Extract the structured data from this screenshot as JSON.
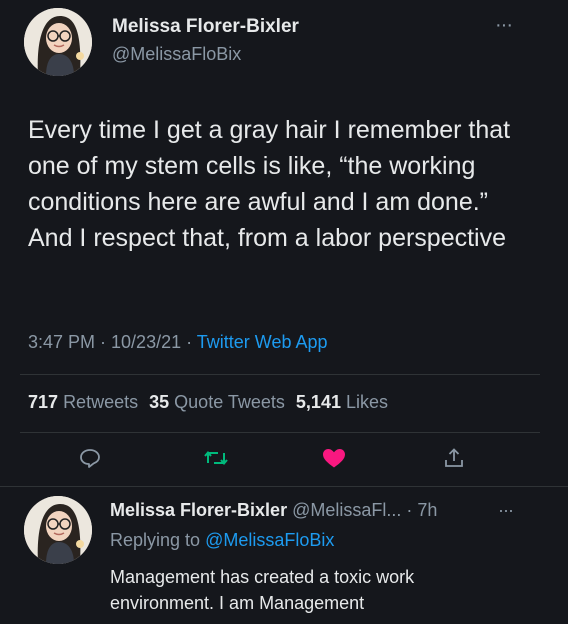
{
  "main_tweet": {
    "display_name": "Melissa Florer-Bixler",
    "handle": "@MelissaFloBix",
    "text": "Every time I get a gray hair I remember that one of my stem cells is like, “the working conditions here are awful and I am done.” And I respect that, from a labor perspective",
    "time": "3:47 PM · 10/23/21 ·",
    "source": "Twitter Web App",
    "retweets_count": "717",
    "retweets_label": "Retweets",
    "quote_count": "35",
    "quote_label": "Quote Tweets",
    "likes_count": "5,141",
    "likes_label": "Likes",
    "more_glyph": "···"
  },
  "actions": {
    "reply_icon": "reply-icon",
    "retweet_icon": "retweet-icon",
    "like_icon": "heart-icon",
    "share_icon": "share-icon",
    "like_color": "#f91880",
    "retweet_color": "#00ba7c"
  },
  "reply_tweet": {
    "display_name": "Melissa Florer-Bixler",
    "handle_time": "@MelissaFl... · 7h",
    "replying_prefix": "Replying to",
    "replying_handle": "@MelissaFloBix",
    "text": "Management has created a toxic work environment. I am Management",
    "more_glyph": "···"
  },
  "colors": {
    "background": "#15171c",
    "accent": "#1d9bf0",
    "text": "#e7e9ea",
    "muted": "#8b98a5"
  }
}
